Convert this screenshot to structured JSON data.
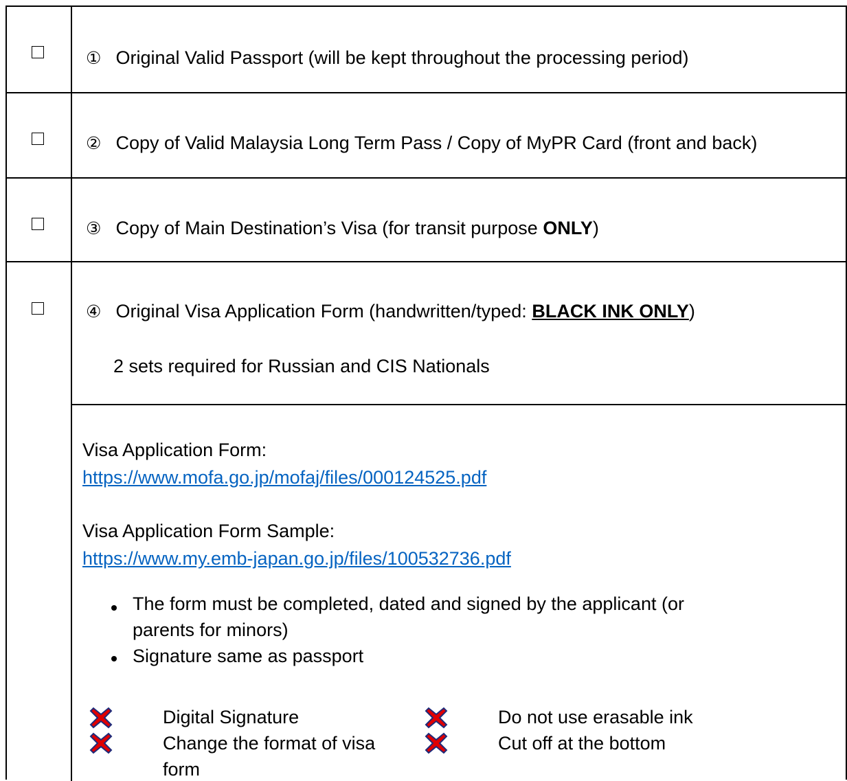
{
  "items": [
    {
      "number": "①",
      "label": "Original Valid Passport (will be kept throughout the processing period)"
    },
    {
      "number": "②",
      "label": "Copy of Valid Malaysia Long Term Pass / Copy of MyPR Card (front and back)"
    },
    {
      "number": "③",
      "label_prefix": "Copy of Main Destination’s Visa (for transit purpose ",
      "label_bold": "ONLY",
      "label_suffix": ")"
    },
    {
      "number": "④",
      "label_prefix": "Original Visa Application Form (handwritten/typed: ",
      "label_bold": "BLACK INK ONLY",
      "label_suffix": ")",
      "note": "2 sets required for Russian and CIS Nationals"
    }
  ],
  "details": {
    "form_label": "Visa Application Form:",
    "form_url": "https://www.mofa.go.jp/mofaj/files/000124525.pdf",
    "sample_label": "Visa Application Form Sample:",
    "sample_url": "https://www.my.emb-japan.go.jp/files/100532736.pdf",
    "bullets": [
      "The form must be completed, dated and signed by the applicant (or",
      "parents for minors)",
      "Signature same as passport"
    ],
    "not_allowed": [
      {
        "icon": "red-x-icon",
        "text": "Digital Signature"
      },
      {
        "icon": "red-x-icon",
        "text": "Change the format of visa"
      },
      {
        "icon": "red-x-icon",
        "text": "form"
      },
      {
        "icon": "red-x-icon",
        "text": "Do not use erasable ink"
      },
      {
        "icon": "red-x-icon",
        "text": "Cut off at the bottom"
      }
    ]
  },
  "colors": {
    "link": "#0563c1",
    "x_fill": "#e00000",
    "x_outline": "#1f2b7a"
  }
}
